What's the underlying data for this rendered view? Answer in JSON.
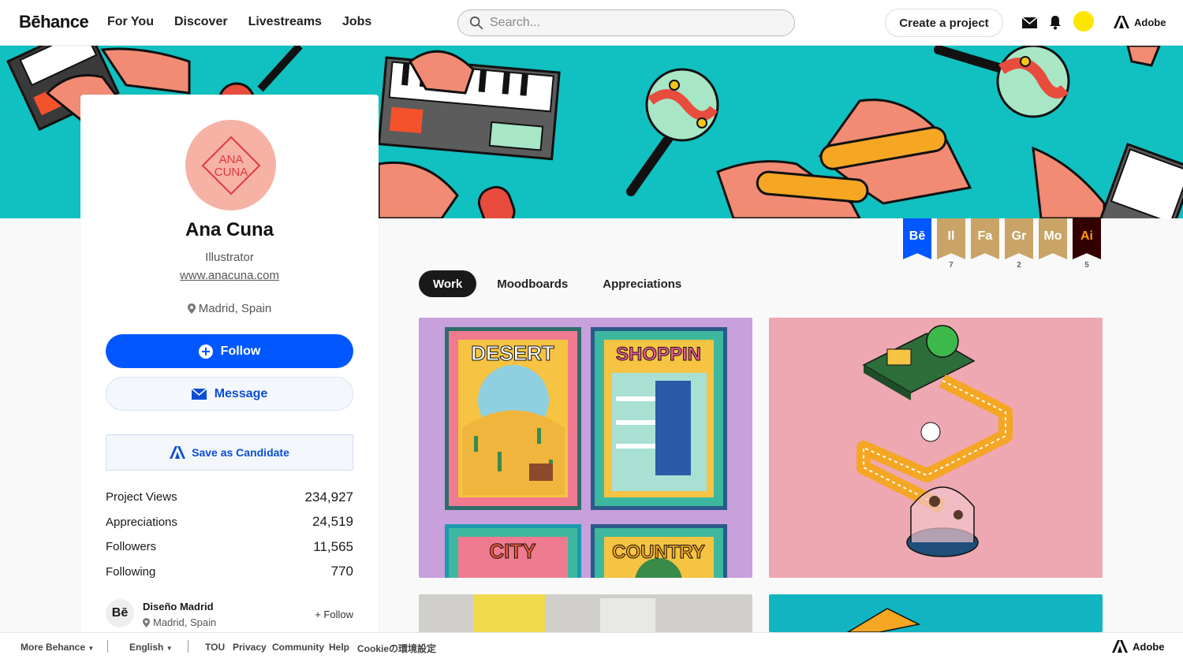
{
  "nav": {
    "logo": "Bēhance",
    "links": [
      "For You",
      "Discover",
      "Livestreams",
      "Jobs"
    ],
    "search_placeholder": "Search...",
    "create_label": "Create a project",
    "adobe_label": "Adobe"
  },
  "profile": {
    "avatar_text_line1": "ANA",
    "avatar_text_line2": "CUNA",
    "name": "Ana Cuna",
    "role": "Illustrator",
    "website": "www.anacuna.com",
    "location": "Madrid, Spain",
    "follow_label": "Follow",
    "message_label": "Message",
    "candidate_label": "Save as Candidate",
    "stats": [
      {
        "label": "Project Views",
        "value": "234,927"
      },
      {
        "label": "Appreciations",
        "value": "24,519"
      },
      {
        "label": "Followers",
        "value": "11,565"
      },
      {
        "label": "Following",
        "value": "770"
      }
    ],
    "team": {
      "logo": "Bē",
      "name": "Diseño Madrid",
      "location": "Madrid, Spain",
      "follow_label": "+ Follow"
    }
  },
  "badges": [
    {
      "label": "Bē",
      "count": "",
      "color": "#0057ff",
      "text_color": "#ffffff"
    },
    {
      "label": "Il",
      "count": "7",
      "color": "#c9a466",
      "text_color": "#ffffff"
    },
    {
      "label": "Fa",
      "count": "",
      "color": "#c9a466",
      "text_color": "#ffffff"
    },
    {
      "label": "Gr",
      "count": "2",
      "color": "#c9a466",
      "text_color": "#ffffff"
    },
    {
      "label": "Mo",
      "count": "",
      "color": "#c9a466",
      "text_color": "#ffffff"
    },
    {
      "label": "Ai",
      "count": "5",
      "color": "#330000",
      "text_color": "#ff9a00"
    }
  ],
  "tabs": [
    {
      "label": "Work",
      "active": true
    },
    {
      "label": "Moodboards",
      "active": false
    },
    {
      "label": "Appreciations",
      "active": false
    }
  ],
  "projects": {
    "poster_titles": [
      "DESERT",
      "SHOPPIN",
      "CITY",
      "COUNTRY"
    ]
  },
  "footer": {
    "more": "More Behance",
    "language": "English",
    "links": [
      "TOU",
      "Privacy",
      "Community",
      "Help",
      "Cookieの環境設定"
    ],
    "adobe_label": "Adobe"
  }
}
